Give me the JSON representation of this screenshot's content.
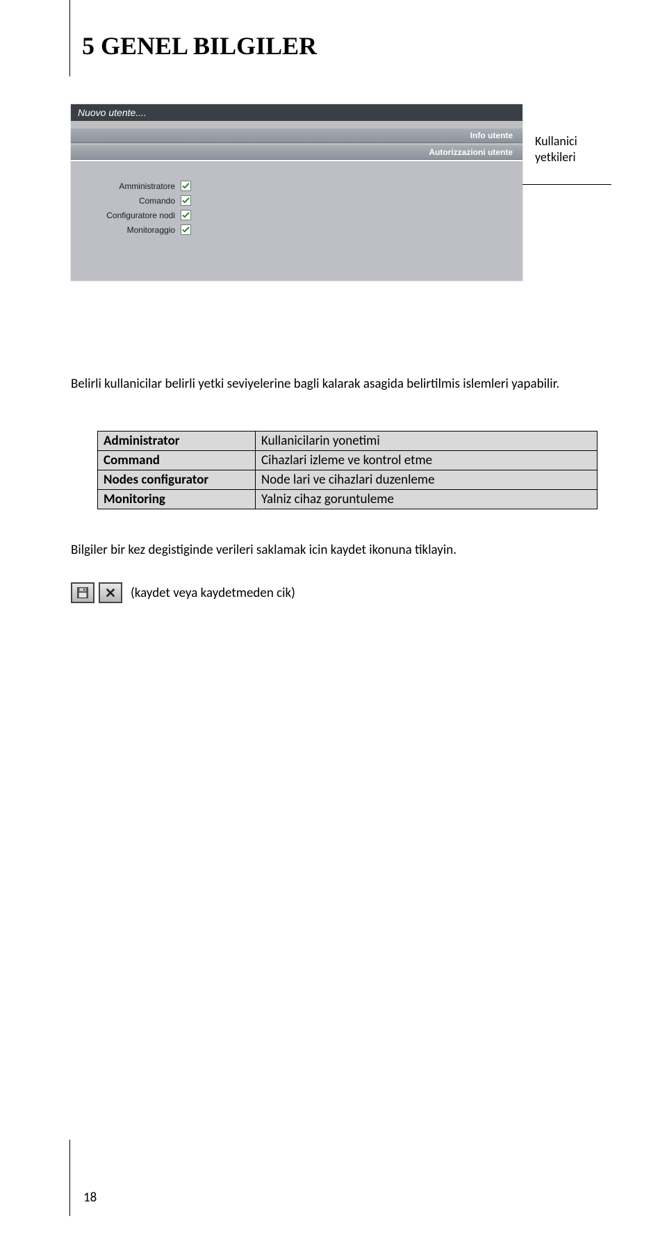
{
  "heading": "5 GENEL BILGILER",
  "annotation": {
    "line1": "Kullanici",
    "line2": "yetkileri"
  },
  "panel": {
    "title": "Nuovo utente....",
    "tab1": "Info utente",
    "tab2": "Autorizzazioni utente",
    "perm1": "Amministratore",
    "perm2": "Comando",
    "perm3": "Configuratore nodi",
    "perm4": "Monitoraggio"
  },
  "intro": "Belirli kullanicilar belirli yetki seviyelerine bagli kalarak asagida belirtilmis islemleri yapabilir.",
  "table": {
    "rows": [
      {
        "k": "Administrator",
        "v": "Kullanicilarin yonetimi"
      },
      {
        "k": "Command",
        "v": "Cihazlari izleme ve kontrol etme"
      },
      {
        "k": "Nodes configurator",
        "v": "Node lari ve cihazlari duzenleme"
      },
      {
        "k": "Monitoring",
        "v": "Yalniz cihaz goruntuleme"
      }
    ]
  },
  "save_text": "Bilgiler bir kez degistiginde verileri saklamak icin kaydet ikonuna tiklayin.",
  "icon_note": "(kaydet veya kaydetmeden cik)",
  "page_number": "18"
}
